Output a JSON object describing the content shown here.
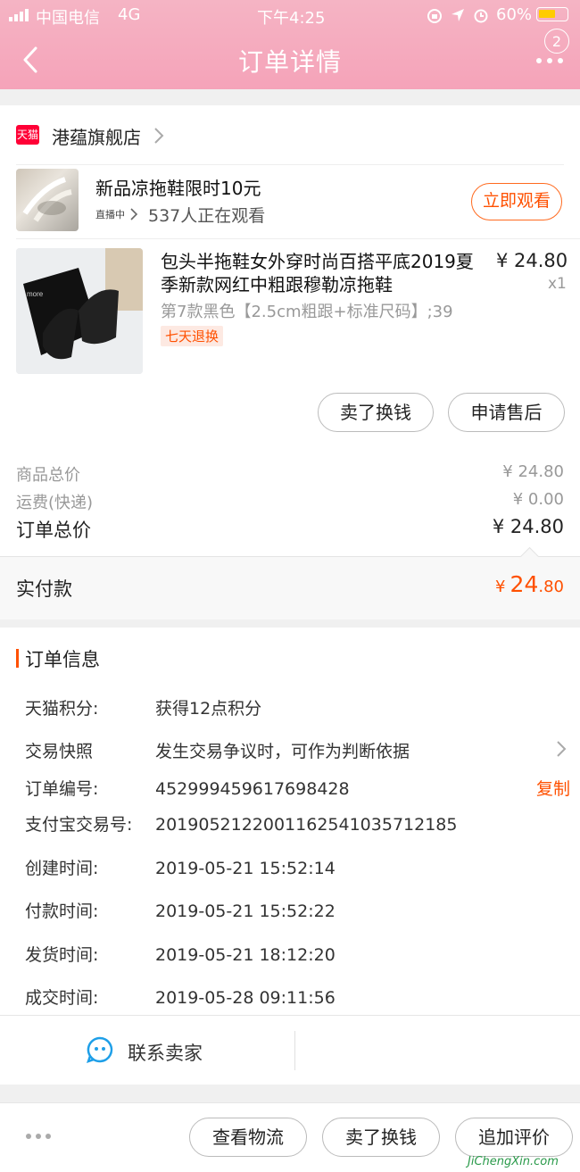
{
  "status": {
    "carrier": "中国电信",
    "network": "4G",
    "time": "下午4:25",
    "battery": "60%"
  },
  "nav": {
    "title": "订单详情",
    "badge_count": "2"
  },
  "shop": {
    "logo_text": "天猫",
    "name": "港蕴旗舰店"
  },
  "live": {
    "title": "新品凉拖鞋限时10元",
    "tag": "直播中",
    "viewers": "537人正在观看",
    "watch_button": "立即观看"
  },
  "item": {
    "title_line1": "包头半拖鞋女外穿时尚百搭平底2019夏",
    "title_line2": "季新款网红中粗跟穆勒凉拖鞋",
    "sku": "第7款黑色【2.5cm粗跟+标准尺码】;39",
    "tag": "七天退换",
    "price": "¥ 24.80",
    "qty": "x1",
    "sell_button": "卖了换钱",
    "aftersale_button": "申请售后"
  },
  "totals": {
    "goods_label": "商品总价",
    "goods_value": "¥ 24.80",
    "shipping_label": "运费(快递)",
    "shipping_value": "¥ 0.00",
    "order_total_label": "订单总价",
    "order_total_value": "¥ 24.80",
    "paid_label": "实付款",
    "paid_currency": "¥",
    "paid_int": "24",
    "paid_dec": ".80"
  },
  "order_info": {
    "heading": "订单信息",
    "rows": [
      {
        "label": "天猫积分:",
        "value": "获得12点积分"
      },
      {
        "label": "交易快照",
        "value": "发生交易争议时，可作为判断依据"
      },
      {
        "label": "订单编号:",
        "value": "452999459617698428"
      },
      {
        "label": "支付宝交易号:",
        "value": "2019052122001162541035712185"
      },
      {
        "label": "创建时间:",
        "value": "2019-05-21 15:52:14"
      },
      {
        "label": "付款时间:",
        "value": "2019-05-21 15:52:22"
      },
      {
        "label": "发货时间:",
        "value": "2019-05-21 18:12:20"
      },
      {
        "label": "成交时间:",
        "value": "2019-05-28 09:11:56"
      }
    ],
    "copy_label": "复制",
    "contact_seller": "联系卖家"
  },
  "bottom": {
    "logistics": "查看物流",
    "sell": "卖了换钱",
    "review": "追加评价"
  },
  "watermark": "JiChengXin.com",
  "colors": {
    "accent": "#ff5000",
    "header_pink": "#f5a3b9",
    "tmall_red": "#ff0036",
    "chat_blue": "#1e9fe8"
  }
}
